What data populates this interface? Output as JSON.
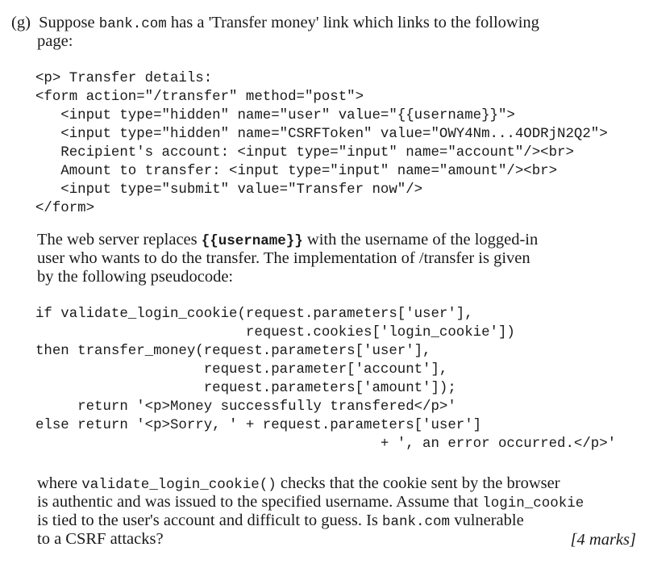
{
  "question": {
    "label": "(g)",
    "intro_line1_a": "Suppose ",
    "intro_line1_b": "bank.com",
    "intro_line1_c": " has a 'Transfer money' link which links to the following",
    "intro_line2": "page:"
  },
  "html_code": [
    "<p> Transfer details:",
    "<form action=\"/transfer\" method=\"post\">",
    "   <input type=\"hidden\" name=\"user\" value=\"{{username}}\">",
    "   <input type=\"hidden\" name=\"CSRFToken\" value=\"OWY4Nm...4ODRjN2Q2\">",
    "   Recipient's account: <input type=\"input\" name=\"account\"/><br>",
    "   Amount to transfer: <input type=\"input\" name=\"amount\"/><br>",
    "   <input type=\"submit\" value=\"Transfer now\"/>",
    "</form>"
  ],
  "explanation": {
    "line1_a": "The web server replaces ",
    "line1_b": "{{username}}",
    "line1_c": " with the username of the logged-in",
    "line2": "user who wants to do the transfer. The implementation of /transfer is given",
    "line3": "by the following pseudocode:"
  },
  "pseudocode": [
    "if validate_login_cookie(request.parameters['user'],",
    "                         request.cookies['login_cookie'])",
    "then transfer_money(request.parameters['user'],",
    "                    request.parameter['account'],",
    "                    request.parameters['amount']);",
    "     return '<p>Money successfully transfered</p>'",
    "else return '<p>Sorry, ' + request.parameters['user']",
    "                                         + ', an error occurred.</p>'"
  ],
  "closing": {
    "line1_a": "where ",
    "line1_b": "validate_login_cookie()",
    "line1_c": " checks that the cookie sent by the browser",
    "line2_a": "is authentic and was issued to the specified username. Assume that ",
    "line2_b": "login_cookie",
    "line3_a": "is tied to the user's account and difficult to guess. Is ",
    "line3_b": "bank.com",
    "line3_c": " vulnerable",
    "line4": "to a CSRF attacks?"
  },
  "marks": "[4 marks]"
}
